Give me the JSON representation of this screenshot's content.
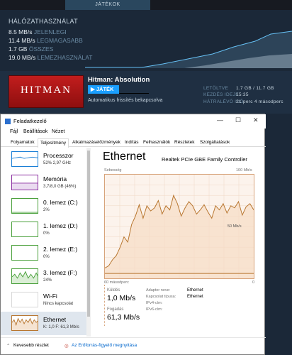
{
  "steam": {
    "tab_label": "JÁTÉKOK",
    "network": {
      "title": "HÁLÓZATHASZNÁLAT",
      "stats": [
        {
          "value": "8.5 MB/s",
          "label": "JELENLEGI"
        },
        {
          "value": "11.4 MB/s",
          "label": "LEGMAGASABB"
        },
        {
          "value": "1.7 GB",
          "label": "ÖSSZES"
        },
        {
          "value": "19.0 MB/s",
          "label": "LEMEZHASZNÁLAT"
        }
      ]
    },
    "game": {
      "title": "Hitman: Absolution",
      "cover_text": "HITMAN",
      "play_label": "JÁTÉK",
      "update_note": "Automatikus frissítés bekapcsolva",
      "details": [
        {
          "label": "LETÖLTVE",
          "value": "1.7 GB / 11.7 GB"
        },
        {
          "label": "KEZDÉS IDEJE",
          "value": "15:35"
        },
        {
          "label": "HÁTRALÉVŐ IDŐ",
          "value": "21 perc 4 másodperc"
        }
      ]
    }
  },
  "taskmgr": {
    "title": "Feladatkezelő",
    "window_controls": [
      "—",
      "☐",
      "✕"
    ],
    "menu": [
      "Fájl",
      "Beállítások",
      "Nézet"
    ],
    "tabs": [
      "Folyamatok",
      "Teljesítmény",
      "Alkalmazáselőzmények",
      "Indítás",
      "Felhasználók",
      "Részletek",
      "Szolgáltatások"
    ],
    "active_tab": "Teljesítmény",
    "sidebar": [
      {
        "name": "Processzor",
        "sub": "52% 2,97 GHz",
        "color": "#1a7fd6"
      },
      {
        "name": "Memória",
        "sub": "3,7/8,0 GB (46%)",
        "color": "#8b2ea0"
      },
      {
        "name": "0. lemez (C:)",
        "sub": "2%",
        "color": "#4aa03b"
      },
      {
        "name": "1. lemez (D:)",
        "sub": "0%",
        "color": "#4aa03b"
      },
      {
        "name": "2. lemez (E:)",
        "sub": "0%",
        "color": "#4aa03b"
      },
      {
        "name": "3. lemez (F:)",
        "sub": "24%",
        "color": "#4aa03b"
      },
      {
        "name": "Wi-Fi",
        "sub": "Nincs kapcsolat",
        "color": "#b8762f"
      },
      {
        "name": "Ethernet",
        "sub": "K: 1,0 F: 61,3 Mb/s",
        "color": "#b8762f"
      }
    ],
    "detail": {
      "heading": "Ethernet",
      "adapter": "Realtek PCIe GBE Family Controller",
      "graph_label": "Sebesség",
      "graph_max": "100 Mb/s",
      "graph_mid": "50 Mb/s",
      "graph_time": "60 másodperc",
      "graph_zero": "0",
      "send_label": "Küldés",
      "send_value": "1,0 Mb/s",
      "recv_label": "Fogadás",
      "recv_value": "61,3 Mb/s",
      "info": [
        {
          "label": "Adapter neve:",
          "value": "Ethernet"
        },
        {
          "label": "Kapcsolat típusa:",
          "value": "Ethernet"
        },
        {
          "label": "IPv4-cím:",
          "value": ""
        },
        {
          "label": "IPv6-cím:",
          "value": ""
        }
      ]
    },
    "footer": {
      "fewer_details": "Kevesebb részlet",
      "resource_monitor": "Az Erőforrás-figyelő megnyitása"
    }
  },
  "chart_data": {
    "type": "area",
    "series": [
      {
        "values": [
          10,
          12,
          18,
          22,
          30,
          40,
          35,
          52,
          60,
          71,
          58,
          70,
          65,
          68,
          75,
          62,
          70,
          66,
          80,
          72,
          60,
          68,
          74,
          70,
          62,
          66,
          71,
          64,
          58,
          70,
          66,
          72,
          63,
          70,
          68,
          74,
          61,
          69,
          72,
          66
        ]
      }
    ],
    "ylim": [
      0,
      100
    ]
  }
}
